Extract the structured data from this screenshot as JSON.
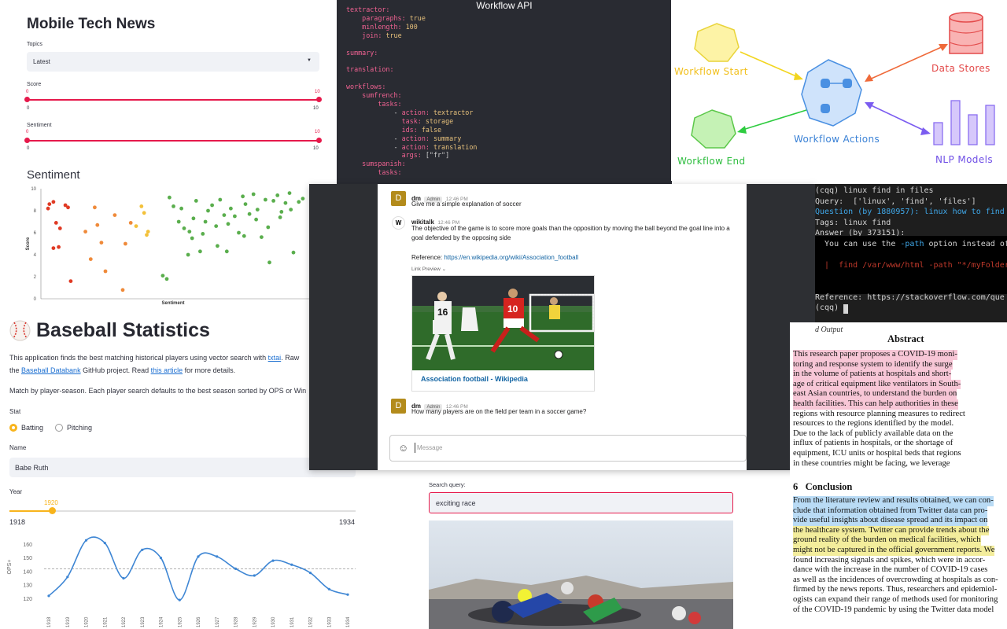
{
  "news": {
    "title": "Mobile Tech News",
    "topics_label": "Topics",
    "topics_value": "Latest",
    "score_label": "Score",
    "score_min": "0",
    "score_max": "10",
    "score_low": "0",
    "score_high": "10",
    "sentiment_label": "Sentiment",
    "sent_min": "0",
    "sent_max": "10",
    "sent_low": "0",
    "sent_high": "10",
    "section_title": "Sentiment",
    "chart_data": {
      "type": "scatter",
      "xlabel": "Sentiment",
      "ylabel": "Score",
      "ylim": [
        0,
        10
      ],
      "yticks": [
        "0",
        "2",
        "4",
        "6",
        "8",
        "10"
      ],
      "colors": [
        "#e03a24",
        "#ef8a3a",
        "#f3c13a",
        "#5aae4d"
      ],
      "points": [
        [
          0.2,
          8.2,
          0
        ],
        [
          0.3,
          8.6,
          0
        ],
        [
          0.6,
          8.8,
          0
        ],
        [
          0.8,
          6.9,
          0
        ],
        [
          1.0,
          4.7,
          0
        ],
        [
          1.5,
          8.5,
          0
        ],
        [
          1.7,
          8.3,
          0
        ],
        [
          0.6,
          4.6,
          0
        ],
        [
          1.9,
          1.6,
          0
        ],
        [
          1.1,
          6.4,
          0
        ],
        [
          3.0,
          6.1,
          1
        ],
        [
          3.4,
          3.6,
          1
        ],
        [
          3.7,
          8.3,
          1
        ],
        [
          3.9,
          6.7,
          1
        ],
        [
          4.2,
          5.1,
          1
        ],
        [
          4.5,
          2.5,
          1
        ],
        [
          5.2,
          7.6,
          1
        ],
        [
          5.8,
          0.8,
          1
        ],
        [
          6.0,
          5.0,
          1
        ],
        [
          6.4,
          6.9,
          1
        ],
        [
          6.8,
          6.6,
          2
        ],
        [
          7.2,
          8.4,
          2
        ],
        [
          7.6,
          5.8,
          2
        ],
        [
          7.7,
          6.1,
          2
        ],
        [
          7.4,
          7.8,
          2
        ],
        [
          8.8,
          2.1,
          3
        ],
        [
          9.1,
          1.8,
          3
        ],
        [
          9.3,
          9.2,
          3
        ],
        [
          9.6,
          8.4,
          3
        ],
        [
          10.0,
          7.0,
          3
        ],
        [
          10.2,
          8.2,
          3
        ],
        [
          10.4,
          6.4,
          3
        ],
        [
          10.8,
          6.1,
          3
        ],
        [
          11.0,
          5.5,
          3
        ],
        [
          11.3,
          8.9,
          3
        ],
        [
          11.6,
          4.3,
          3
        ],
        [
          12.0,
          7.0,
          3
        ],
        [
          12.2,
          8.0,
          3
        ],
        [
          12.5,
          8.5,
          3
        ],
        [
          12.8,
          6.6,
          3
        ],
        [
          13.1,
          9.0,
          3
        ],
        [
          13.4,
          7.6,
          3
        ],
        [
          13.6,
          4.3,
          3
        ],
        [
          13.9,
          8.2,
          3
        ],
        [
          14.2,
          7.5,
          3
        ],
        [
          14.5,
          6.0,
          3
        ],
        [
          14.8,
          9.3,
          3
        ],
        [
          15.0,
          8.6,
          3
        ],
        [
          15.3,
          7.7,
          3
        ],
        [
          15.6,
          9.5,
          3
        ],
        [
          15.9,
          8.1,
          3
        ],
        [
          16.2,
          5.6,
          3
        ],
        [
          16.5,
          9.0,
          3
        ],
        [
          16.8,
          3.3,
          3
        ],
        [
          17.1,
          8.9,
          3
        ],
        [
          17.4,
          9.4,
          3
        ],
        [
          17.7,
          7.9,
          3
        ],
        [
          18.0,
          8.7,
          3
        ],
        [
          18.3,
          9.6,
          3
        ],
        [
          18.6,
          4.2,
          3
        ],
        [
          19.0,
          8.8,
          3
        ],
        [
          19.3,
          9.1,
          3
        ],
        [
          10.7,
          4.0,
          3
        ],
        [
          11.8,
          5.9,
          3
        ],
        [
          12.9,
          4.8,
          3
        ],
        [
          13.7,
          6.8,
          3
        ],
        [
          14.9,
          5.7,
          3
        ],
        [
          15.8,
          7.2,
          3
        ],
        [
          16.7,
          6.5,
          3
        ],
        [
          17.6,
          7.4,
          3
        ],
        [
          18.4,
          8.1,
          3
        ],
        [
          11.1,
          7.3,
          3
        ]
      ]
    }
  },
  "code": {
    "title": "Workflow API"
  },
  "diagram": {
    "workflow_start": "Workflow Start",
    "workflow_actions": "Workflow Actions",
    "workflow_end": "Workflow End",
    "data_stores": "Data Stores",
    "nlp_models": "NLP Models"
  },
  "baseball": {
    "title": "Baseball Statistics",
    "p1a": "This application finds the best matching historical players using vector search with ",
    "p1_link1": "txtai",
    "p1b": ". Raw",
    "p2a": "the ",
    "p2_link": "Baseball Databank",
    "p2b": " GitHub project. Read ",
    "p2_link2": "this article",
    "p2c": " for more details.",
    "p3": "Match by player-season. Each player search defaults to the best season sorted by OPS or Win",
    "stat_label": "Stat",
    "batting": "Batting",
    "pitching": "Pitching",
    "name_label": "Name",
    "name_value": "Babe Ruth",
    "year_label": "Year",
    "year_value": "1920",
    "year_min": "1918",
    "year_max": "1934",
    "chart_data": {
      "type": "line",
      "ylabel": "OPS+",
      "yticks": [
        120,
        130,
        140,
        150,
        160
      ],
      "ylim": [
        115,
        166
      ],
      "reference_line": 142,
      "categories": [
        "1918",
        "1919",
        "1920",
        "1921",
        "1922",
        "1923",
        "1924",
        "1925",
        "1926",
        "1927",
        "1928",
        "1929",
        "1930",
        "1931",
        "1932",
        "1933",
        "1934"
      ],
      "values": [
        122,
        136,
        163,
        161,
        135,
        156,
        150,
        119,
        151,
        151,
        142,
        137,
        148,
        145,
        139,
        127,
        123
      ]
    }
  },
  "chat": {
    "m1_user": "dm",
    "m1_badge": "Admin",
    "m1_time": "12:46 PM",
    "m1_text": "Give me a simple explanation of soccer",
    "m2_user": "wikitalk",
    "m2_time": "12:46 PM",
    "m2_line1": "The objective of the game is to score more goals than the opposition by moving the ball beyond the goal line into a",
    "m2_line2": "goal defended by the opposing side",
    "m2_ref_label": "Reference: ",
    "m2_ref_url": "https://en.wikipedia.org/wiki/Association_football",
    "link_preview": "Link Preview",
    "card_title": "Association football - Wikipedia",
    "m3_user": "dm",
    "m3_badge": "Admin",
    "m3_time": "12:46 PM",
    "m3_text": "How many players are on the field per team in a soccer game?",
    "composer_placeholder": "Message"
  },
  "terminal": {
    "l1": "(cqq) linux find in files",
    "l2": "Query:  ['linux', 'find', 'files']",
    "l3": "Question (by 1880957): linux how to find",
    "l4": "Tags: linux find",
    "l5": "Answer (by 373151):",
    "l6a": "  You can use the ",
    "l6b": "-path",
    "l6c": " option instead of",
    "l7": "  |  find /var/www/html -path \"*/myFolder",
    "l8": "Reference: https://stackoverflow.com/que",
    "l9": "(cqq) "
  },
  "paper": {
    "fig_label": "d Output",
    "abstract_title": "Abstract",
    "abstract_lines": [
      "This research paper proposes a COVID-19 moni-",
      "toring and response system to identify the surge",
      "in the volume of patients at hospitals and short-",
      "age of critical equipment like ventilators in South-",
      "east Asian countries, to understand the burden on",
      "health facilities. This can help authorities in these",
      "regions with resource planning measures to redirect",
      "resources to the regions identified by the model.",
      "Due to the lack of publicly available data on the",
      "influx of patients in hospitals, or the shortage of",
      "equipment, ICU units or hospital beds that regions",
      "in these countries might be facing, we leverage"
    ],
    "conclusion_title": "6   Conclusion",
    "conclusion_lines": [
      "From the literature review and results obtained, we can con-",
      "clude that information obtained from Twitter data can pro-",
      "vide useful insights about disease spread and its impact on",
      "the healthcare system.  Twitter can provide trends about the",
      "ground reality of the burden on medical facilities, which",
      "might not be captured in the official government reports. We",
      "found increasing signals and spikes, which were in accor-",
      "dance with the increase in the number of COVID-19 cases",
      "as well as the incidences of overcrowding at hospitals as con-",
      "firmed by the news reports. Thus, researchers and epidemiol-",
      "ogists can expand their range of methods used for monitoring",
      "of the COVID-19 pandemic by using the Twitter data model"
    ],
    "highlight_pink": "#f7c6d6",
    "highlight_blue": "#b9dbf5",
    "highlight_yellow": "#f3ed9c"
  },
  "search": {
    "label": "Search query:",
    "value": "exciting race"
  }
}
